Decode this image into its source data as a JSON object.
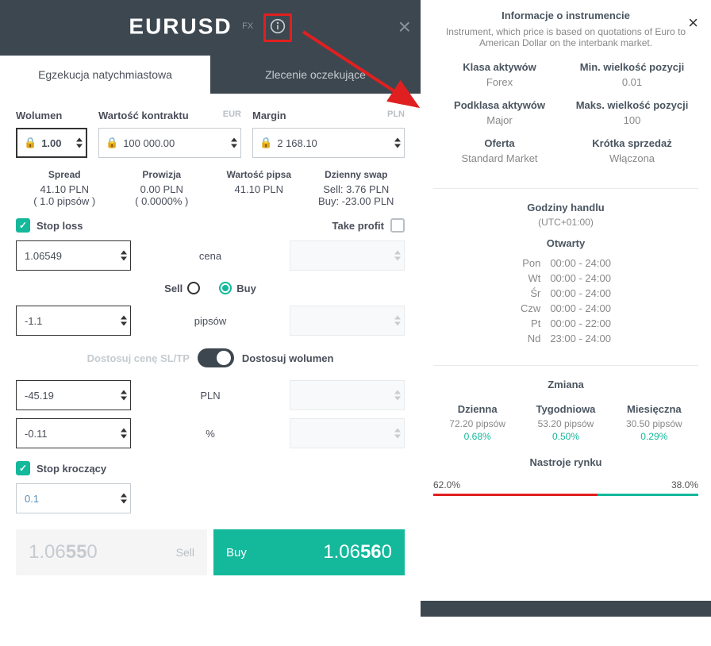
{
  "header": {
    "symbol": "EURUSD",
    "fx": "FX"
  },
  "tabs": {
    "immediate": "Egzekucja natychmiastowa",
    "pending": "Zlecenie oczekujące"
  },
  "form": {
    "volume_label": "Wolumen",
    "volume_value": "1.00",
    "contract_label": "Wartość kontraktu",
    "contract_currency": "EUR",
    "contract_value": "100 000.00",
    "margin_label": "Margin",
    "margin_currency": "PLN",
    "margin_value": "2 168.10"
  },
  "info": {
    "spread_label": "Spread",
    "spread_value": "41.10 PLN",
    "spread_pips": "( 1.0 pipsów )",
    "commission_label": "Prowizja",
    "commission_value": "0.00 PLN",
    "commission_pct": "( 0.0000% )",
    "pip_label": "Wartość pipsa",
    "pip_value": "41.10 PLN",
    "swap_label": "Dzienny swap",
    "swap_sell": "Sell: 3.76 PLN",
    "swap_buy": "Buy: -23.00 PLN"
  },
  "sl": {
    "stop_loss_label": "Stop loss",
    "take_profit_label": "Take profit",
    "price_label": "cena",
    "price_value": "1.06549",
    "sell_label": "Sell",
    "buy_label": "Buy",
    "pips_label": "pipsów",
    "pips_value": "-1.1",
    "adjust_sltp": "Dostosuj cenę SL/TP",
    "adjust_volume": "Dostosuj wolumen",
    "pln_label": "PLN",
    "pln_value": "-45.19",
    "pct_label": "%",
    "pct_value": "-0.11",
    "trailing_label": "Stop kroczący",
    "trailing_value": "0.1"
  },
  "actions": {
    "sell_label": "Sell",
    "sell_price_pre": "1.06",
    "sell_price_bold": "55",
    "sell_price_post": "0",
    "buy_label": "Buy",
    "buy_price_pre": "1.06",
    "buy_price_bold": "56",
    "buy_price_post": "0"
  },
  "info_panel": {
    "title": "Informacje o instrumencie",
    "description": "Instrument, which price is based on quotations of Euro to American Dollar on the interbank market.",
    "props": [
      {
        "title": "Klasa aktywów",
        "value": "Forex"
      },
      {
        "title": "Min. wielkość pozycji",
        "value": "0.01"
      },
      {
        "title": "Podklasa aktywów",
        "value": "Major"
      },
      {
        "title": "Maks. wielkość pozycji",
        "value": "100"
      },
      {
        "title": "Oferta",
        "value": "Standard Market"
      },
      {
        "title": "Krótka sprzedaż",
        "value": "Włączona"
      }
    ],
    "hours": {
      "title": "Godziny handlu",
      "tz": "(UTC+01:00)",
      "status": "Otwarty",
      "days": [
        {
          "day": "Pon",
          "time": "00:00 - 24:00"
        },
        {
          "day": "Wt",
          "time": "00:00 - 24:00"
        },
        {
          "day": "Śr",
          "time": "00:00 - 24:00"
        },
        {
          "day": "Czw",
          "time": "00:00 - 24:00"
        },
        {
          "day": "Pt",
          "time": "00:00 - 22:00"
        },
        {
          "day": "Nd",
          "time": "23:00 - 24:00"
        }
      ]
    },
    "change": {
      "title": "Zmiana",
      "items": [
        {
          "period": "Dzienna",
          "pips": "72.20 pipsów",
          "pct": "0.68%"
        },
        {
          "period": "Tygodniowa",
          "pips": "53.20 pipsów",
          "pct": "0.50%"
        },
        {
          "period": "Miesięczna",
          "pips": "30.50 pipsów",
          "pct": "0.29%"
        }
      ]
    },
    "sentiment": {
      "title": "Nastroje rynku",
      "left": "62.0%",
      "right": "38.0%",
      "left_width": 62,
      "right_width": 38
    }
  }
}
